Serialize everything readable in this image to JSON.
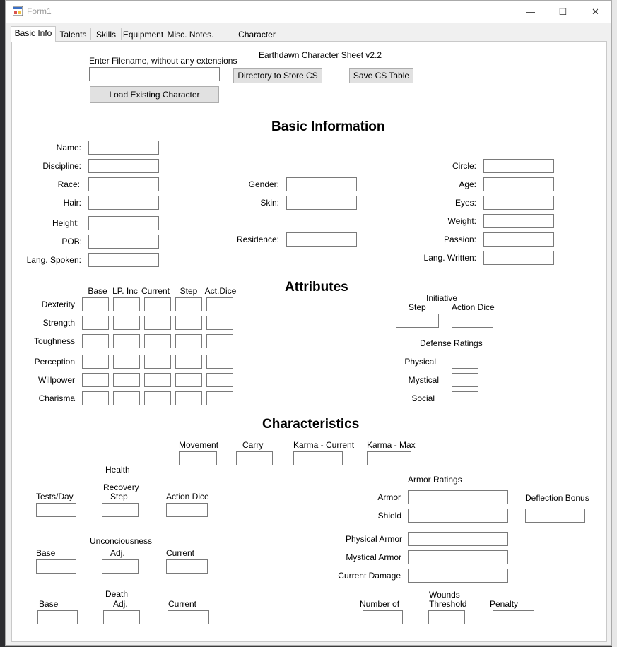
{
  "window": {
    "title": "Form1",
    "minimize": "—",
    "maximize": "☐",
    "close": "✕"
  },
  "tabs": [
    "Basic Info",
    "Talents",
    "Skills",
    "Equipment",
    "Misc. Notes.",
    "Character Background"
  ],
  "file": {
    "filename_label": "Enter Filename, without any extensions",
    "filename_value": "",
    "load_button": "Load Existing Character",
    "app_title": "Earthdawn Character Sheet v2.2",
    "directory_button": "Directory to Store CS",
    "save_button": "Save CS Table"
  },
  "basic": {
    "heading": "Basic Information",
    "name": "Name:",
    "discipline": "Discipline:",
    "race": "Race:",
    "hair": "Hair:",
    "height": "Height:",
    "pob": "POB:",
    "lang_spoken": "Lang. Spoken:",
    "gender": "Gender:",
    "skin": "Skin:",
    "residence": "Residence:",
    "circle": "Circle:",
    "age": "Age:",
    "eyes": "Eyes:",
    "weight": "Weight:",
    "passion": "Passion:",
    "lang_written": "Lang. Written:"
  },
  "attributes": {
    "heading": "Attributes",
    "cols": [
      "Base",
      "LP. Inc",
      "Current",
      "Step",
      "Act.Dice"
    ],
    "rows": [
      "Dexterity",
      "Strength",
      "Toughness",
      "Perception",
      "Willpower",
      "Charisma"
    ],
    "initiative": "Initiative",
    "init_step": "Step",
    "init_action_dice": "Action Dice",
    "defense": "Defense Ratings",
    "physical": "Physical",
    "mystical": "Mystical",
    "social": "Social"
  },
  "characteristics": {
    "heading": "Characteristics",
    "movement": "Movement",
    "carry": "Carry",
    "karma_current": "Karma - Current",
    "karma_max": "Karma - Max",
    "health": "Health",
    "recovery": "Recovery",
    "recovery_step": "Step",
    "tests_day": "Tests/Day",
    "action_dice": "Action Dice",
    "unconsciousness": "Unconciousness",
    "unc_base": "Base",
    "unc_adj": "Adj.",
    "unc_current": "Current",
    "death": "Death",
    "death_base": "Base",
    "death_adj": "Adj.",
    "death_current": "Current",
    "armor_ratings": "Armor Ratings",
    "armor": "Armor",
    "shield": "Shield",
    "deflection": "Deflection Bonus",
    "physical_armor": "Physical Armor",
    "mystical_armor": "Mystical Armor",
    "current_damage": "Current Damage",
    "wounds": "Wounds",
    "number_of": "Number of",
    "threshold": "Threshold",
    "penalty": "Penalty"
  }
}
